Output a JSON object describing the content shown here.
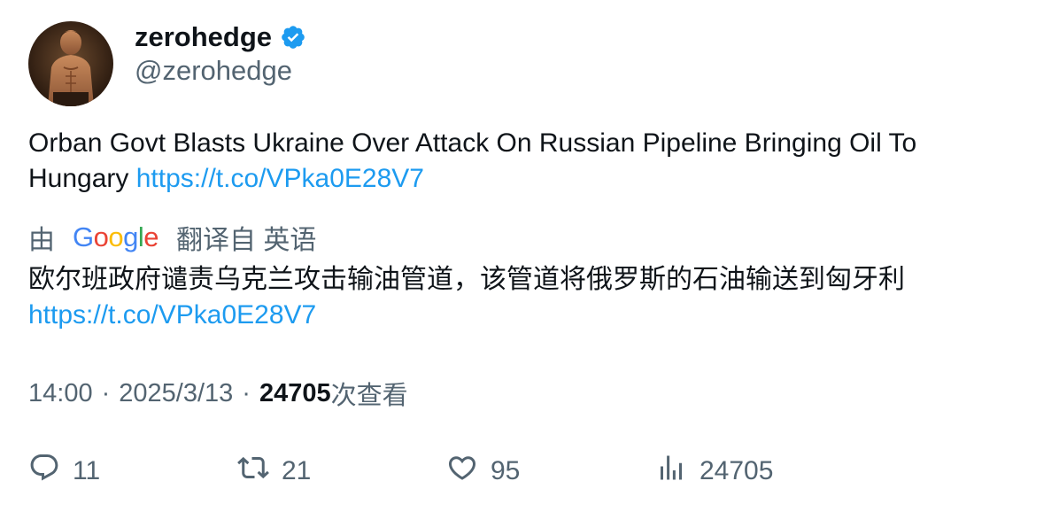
{
  "author": {
    "display_name": "zerohedge",
    "handle": "@zerohedge",
    "verified": true
  },
  "tweet": {
    "text": "Orban Govt Blasts Ukraine Over Attack On Russian Pipeline Bringing Oil To Hungary",
    "link": "https://t.co/VPka0E28V7"
  },
  "translation": {
    "prefix": "由",
    "provider": [
      "G",
      "o",
      "o",
      "g",
      "l",
      "e"
    ],
    "suffix": "翻译自 英语",
    "text": "欧尔班政府谴责乌克兰攻击输油管道，该管道将俄罗斯的石油输送到匈牙利",
    "link": "https://t.co/VPka0E28V7"
  },
  "meta": {
    "time": "14:00",
    "separator": "·",
    "date": "2025/3/13",
    "views_count": "24705",
    "views_label": "次查看"
  },
  "actions": {
    "replies": "11",
    "retweets": "21",
    "likes": "95",
    "views": "24705"
  },
  "colors": {
    "link": "#1d9bf0",
    "secondary_text": "#536471",
    "verified_badge": "#1d9bf0",
    "google_blue": "#4285f4",
    "google_red": "#ea4335",
    "google_yellow": "#fbbc05",
    "google_green": "#34a853"
  }
}
